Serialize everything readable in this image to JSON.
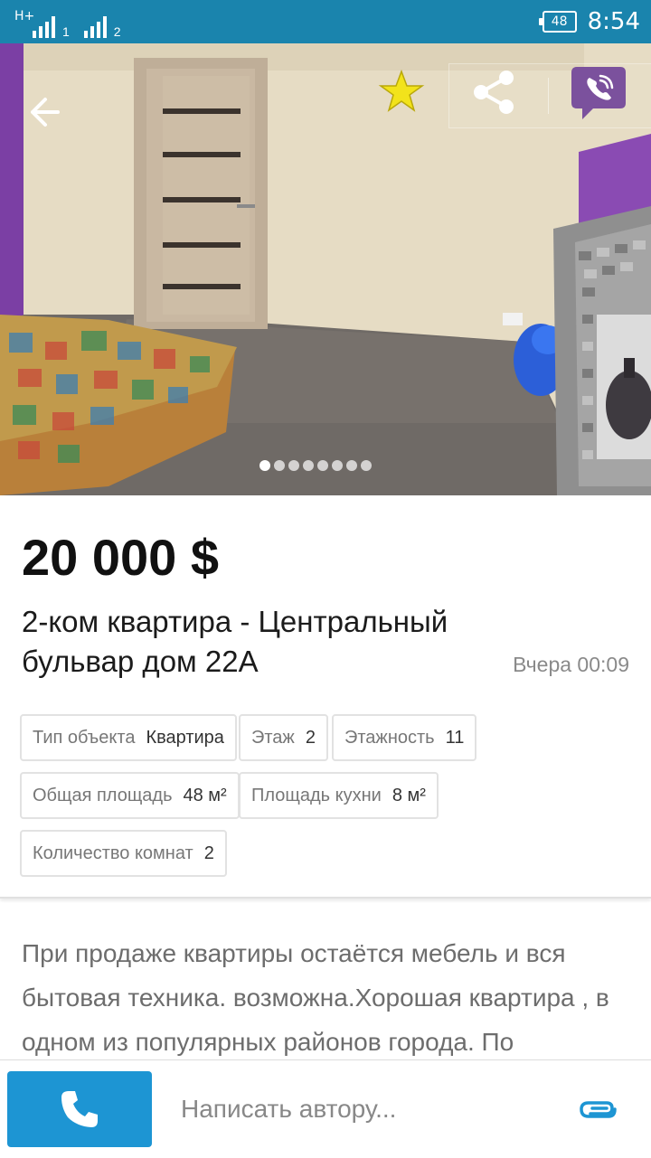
{
  "status_bar": {
    "network": "H+",
    "sim1": "1",
    "sim2": "2",
    "battery": "48",
    "time": "8:54",
    "color": "#1a84ad"
  },
  "gallery": {
    "photo_count": 8,
    "active_index": 0,
    "icons": [
      "back-arrow-icon",
      "star-icon",
      "share-icon",
      "viber-icon"
    ],
    "star_color": "#f2e31b",
    "viber_color": "#7b519d"
  },
  "listing": {
    "price": "20 000 $",
    "title": "2-ком квартира - Центральный бульвар дом 22А",
    "date": "Вчера 00:09"
  },
  "attributes": [
    {
      "key": "Тип объекта",
      "value": "Квартира"
    },
    {
      "key": "Этаж",
      "value": "2"
    },
    {
      "key": "Этажность",
      "value": "11"
    },
    {
      "key": "Общая площадь",
      "value": "48 м²"
    },
    {
      "key": "Площадь кухни",
      "value": "8 м²"
    },
    {
      "key": "Количество комнат",
      "value": "2"
    }
  ],
  "description": "При продаже квартиры остаётся мебель и вся бытовая техника.  возможна.Хорошая квартира , в одном из популярных районов города. По",
  "bottom_bar": {
    "message_placeholder": "Написать автору...",
    "call_color": "#1d95d3",
    "icons": [
      "phone-icon",
      "attachment-icon"
    ]
  }
}
